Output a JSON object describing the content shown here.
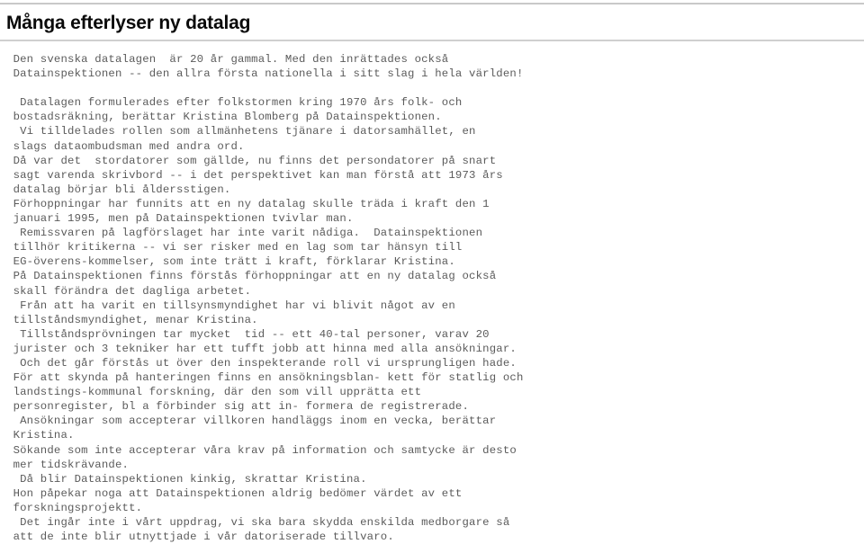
{
  "document": {
    "title": "Många efterlyser ny datalag",
    "body": " Den svenska datalagen  är 20 år gammal. Med den inrättades också\n Datainspektionen -- den allra första nationella i sitt slag i hela världen!\n\n  Datalagen formulerades efter folkstormen kring 1970 års folk- och\n bostadsräkning, berättar Kristina Blomberg på Datainspektionen.\n  Vi tilldelades rollen som allmänhetens tjänare i datorsamhället, en\n slags dataombudsman med andra ord.\n Då var det  stordatorer som gällde, nu finns det persondatorer på snart\n sagt varenda skrivbord -- i det perspektivet kan man förstå att 1973 års\n datalag börjar bli åldersstigen.\n Förhoppningar har funnits att en ny datalag skulle träda i kraft den 1\n januari 1995, men på Datainspektionen tvivlar man.\n  Remissvaren på lagförslaget har inte varit nådiga.  Datainspektionen\n tillhör kritikerna -- vi ser risker med en lag som tar hänsyn till\n EG-överens-kommelser, som inte trätt i kraft, förklarar Kristina.\n På Datainspektionen finns förstås förhoppningar att en ny datalag också\n skall förändra det dagliga arbetet.\n  Från att ha varit en tillsynsmyndighet har vi blivit något av en\n tillståndsmyndighet, menar Kristina.\n  Tillståndsprövningen tar mycket  tid -- ett 40-tal personer, varav 20\n jurister och 3 tekniker har ett tufft jobb att hinna med alla ansökningar.\n  Och det går förstås ut över den inspekterande roll vi ursprungligen hade.\n För att skynda på hanteringen finns en ansökningsblan- kett för statlig och\n landstings-kommunal forskning, där den som vill upprätta ett\n personregister, bl a förbinder sig att in- formera de registrerade.\n  Ansökningar som accepterar villkoren handläggs inom en vecka, berättar\n Kristina.\n Sökande som inte accepterar våra krav på information och samtycke är desto\n mer tidskrävande.\n  Då blir Datainspektionen kinkig, skrattar Kristina.\n Hon påpekar noga att Datainspektionen aldrig bedömer värdet av ett\n forskningsprojektt.\n  Det ingår inte i vårt uppdrag, vi ska bara skydda enskilda medborgare så\n att de inte blir utnyttjade i vår datoriserade tillvaro."
  },
  "colors": {
    "page_background": "#ffffff",
    "title_text": "#0a0a0a",
    "body_text": "#5b5b5b",
    "rule": "#c9c9c9"
  }
}
